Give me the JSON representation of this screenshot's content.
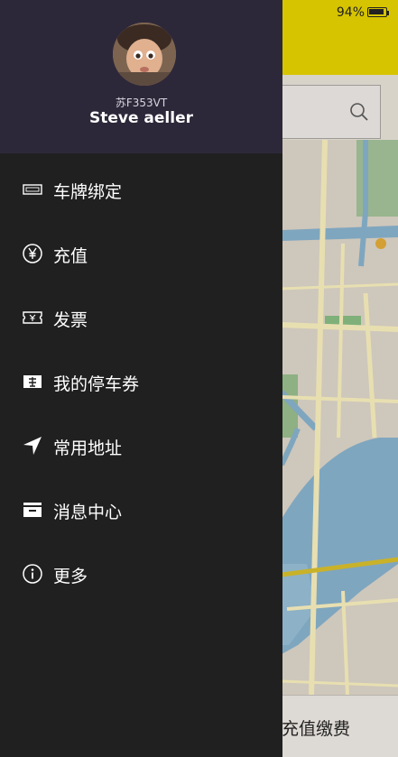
{
  "status_bar": {
    "battery": "94%"
  },
  "drawer": {
    "plate": "苏F353VT",
    "user_name": "Steve aeller",
    "menu": [
      {
        "label": "车牌绑定",
        "icon": "license-plate-icon"
      },
      {
        "label": "充值",
        "icon": "yen-coin-icon"
      },
      {
        "label": "发票",
        "icon": "invoice-icon"
      },
      {
        "label": "我的停车券",
        "icon": "ticket-icon"
      },
      {
        "label": "常用地址",
        "icon": "location-arrow-icon"
      },
      {
        "label": "消息中心",
        "icon": "inbox-icon"
      },
      {
        "label": "更多",
        "icon": "info-icon"
      }
    ]
  },
  "bottom": {
    "label": "充值缴费"
  },
  "colors": {
    "drawer_bg": "#202020",
    "header_bg": "#2d2839",
    "topbar_accent": "#d6c400"
  }
}
